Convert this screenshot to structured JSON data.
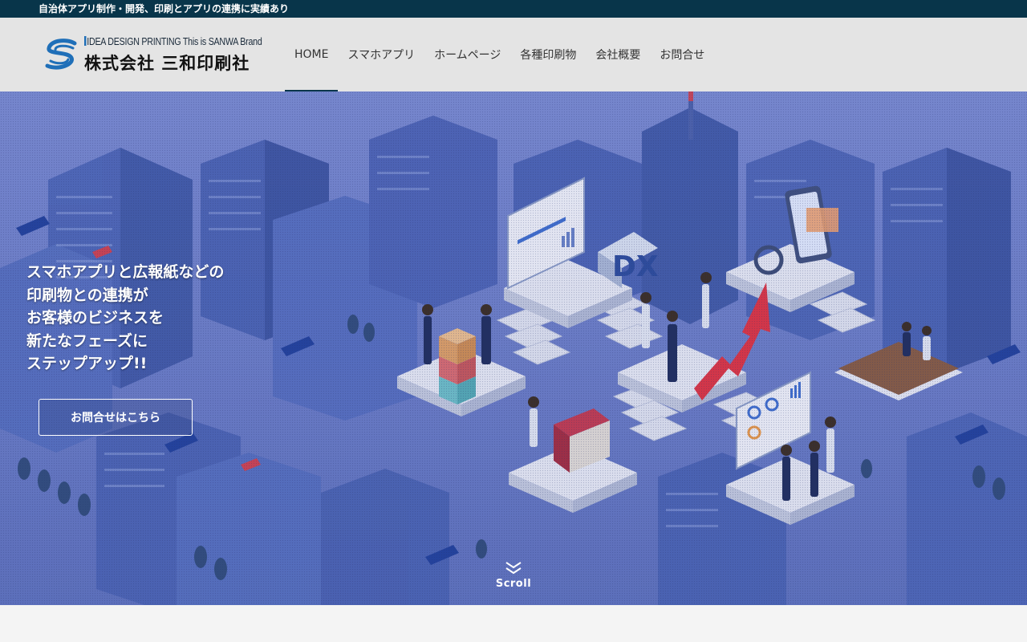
{
  "topbar": {
    "text": "自治体アプリ制作・開発、印刷とアプリの連携に実績あり"
  },
  "logo": {
    "tagline": "IDEA DESIGN PRINTING This is SANWA Brand",
    "company": "株式会社 三和印刷社",
    "icon": "sanwa-s-logo"
  },
  "nav": {
    "items": [
      {
        "label": "HOME"
      },
      {
        "label": "スマホアプリ"
      },
      {
        "label": "ホームページ"
      },
      {
        "label": "各種印刷物"
      },
      {
        "label": "会社概要"
      },
      {
        "label": "お問合せ"
      }
    ],
    "active_index": 0
  },
  "hero": {
    "lines": [
      "スマホアプリと広報紙などの",
      "印刷物との連携が",
      "お客様のビジネスを",
      "新たなフェーズに",
      "ステップアップ!!"
    ],
    "cta_label": "お問合せはこちら",
    "scroll_label": "Scroll",
    "scroll_icon": "double-chevron-down-icon",
    "illustration_label": "DX",
    "colors": {
      "bg": "#6f7fc7",
      "building": "#4a63b5",
      "platform": "#f2f3f7",
      "accent": "#e5323c"
    }
  }
}
